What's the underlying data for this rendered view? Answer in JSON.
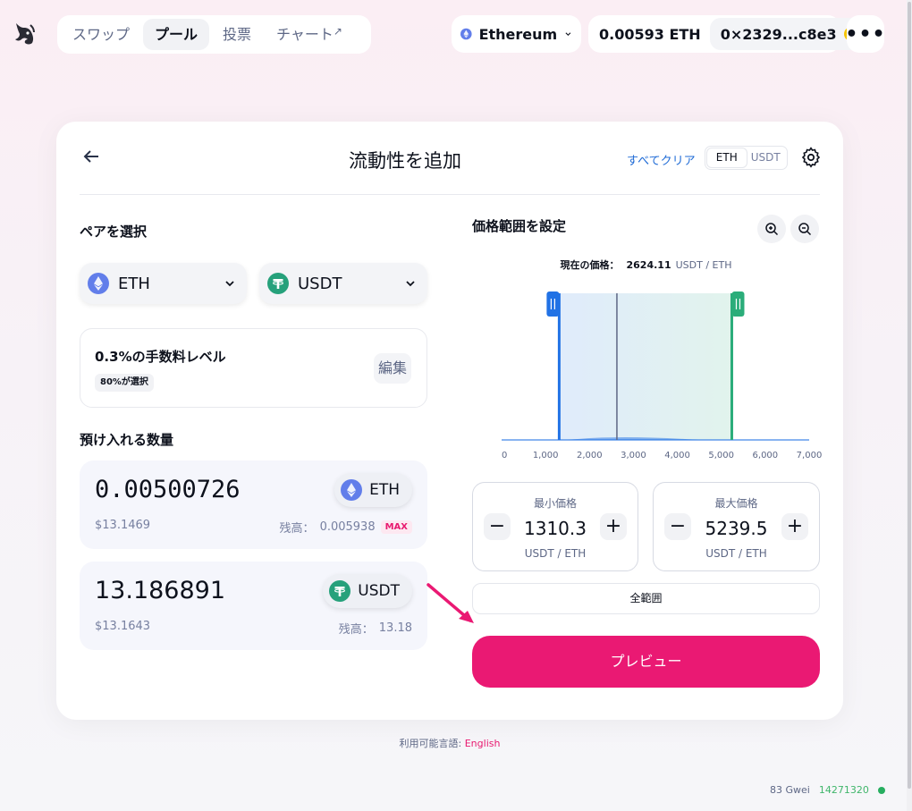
{
  "nav": {
    "items": [
      {
        "label": "スワップ",
        "active": false
      },
      {
        "label": "プール",
        "active": true
      },
      {
        "label": "投票",
        "active": false
      },
      {
        "label": "チャート",
        "active": false,
        "external_icon": "↗"
      }
    ]
  },
  "chain": {
    "name": "Ethereum"
  },
  "wallet": {
    "balance": "0.00593 ETH",
    "address": "0×2329...c8e3"
  },
  "card": {
    "title": "流動性を追加",
    "clear_all": "すべてクリア",
    "toggle": {
      "left": "ETH",
      "right": "USDT",
      "selected": "ETH"
    }
  },
  "pair": {
    "label": "ペアを選択",
    "token_a": "ETH",
    "token_b": "USDT"
  },
  "fee": {
    "title": "0.3%の手数料レベル",
    "badge": "80%が選択",
    "edit": "編集"
  },
  "deposit": {
    "label": "預け入れる数量",
    "a": {
      "amount": "0.00500726",
      "usd": "$13.1469",
      "token": "ETH",
      "balance_label": "残高：",
      "balance": "0.005938",
      "max": "MAX"
    },
    "b": {
      "amount": "13.186891",
      "usd": "$13.1643",
      "token": "USDT",
      "balance_label": "残高：",
      "balance": "13.18"
    }
  },
  "price_range": {
    "label": "価格範囲を設定",
    "current_label": "現在の価格：",
    "current_value": "2624.11",
    "current_unit": "USDT / ETH",
    "min": {
      "title": "最小価格",
      "value": "1310.3",
      "unit": "USDT / ETH"
    },
    "max": {
      "title": "最大価格",
      "value": "5239.5",
      "unit": "USDT / ETH"
    },
    "full_range": "全範囲",
    "preview": "プレビュー"
  },
  "chart_data": {
    "type": "area",
    "x_ticks": [
      "0",
      "1,000",
      "2,000",
      "3,000",
      "4,000",
      "5,000",
      "6,000",
      "7,000"
    ],
    "xlim": [
      0,
      7000
    ],
    "current_price": 2624.11,
    "range_min": 1310.3,
    "range_max": 5239.5,
    "colors": {
      "min_handle": "#2172e5",
      "max_handle": "#2bad7a",
      "current_line": "#5d6785",
      "liquidity": "#2172e5"
    }
  },
  "footer": {
    "lang_label": "利用可能言語: ",
    "lang_link": "English",
    "gas": "83 Gwei",
    "block": "14271320"
  }
}
